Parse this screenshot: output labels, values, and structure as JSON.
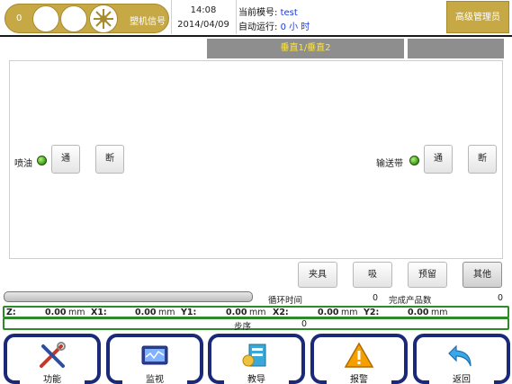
{
  "header": {
    "signal_count": "0",
    "signal_label": "塑机信号",
    "time": "14:08",
    "date": "2014/04/09",
    "mold_label": "当前模号:",
    "mold_value": "test",
    "auto_label": "自动运行:",
    "auto_value": "0 小 时",
    "admin_label": "高级管理员"
  },
  "tabs": {
    "active_label": "垂直1/垂直2",
    "second_label": ""
  },
  "controls": {
    "spray_label": "喷油",
    "spray_on": "通",
    "spray_off": "断",
    "conveyor_label": "输送带",
    "conveyor_on": "通",
    "conveyor_off": "断"
  },
  "actions": {
    "clamp": "夹具",
    "suction": "吸",
    "reserve": "预留",
    "other": "其他"
  },
  "status": {
    "cycle_time_label": "循环时间",
    "cycle_time_value": "0",
    "finished_label": "完成产品数",
    "finished_value": "0",
    "progress": 0
  },
  "coords": [
    {
      "label": "Z:",
      "value": "0.00",
      "unit": "mm"
    },
    {
      "label": "X1:",
      "value": "0.00",
      "unit": "mm"
    },
    {
      "label": "Y1:",
      "value": "0.00",
      "unit": "mm"
    },
    {
      "label": "X2:",
      "value": "0.00",
      "unit": "mm"
    },
    {
      "label": "Y2:",
      "value": "0.00",
      "unit": "mm"
    }
  ],
  "step": {
    "label": "步序",
    "value": "0"
  },
  "nav": [
    {
      "label": "功能",
      "icon": "tools-icon"
    },
    {
      "label": "监视",
      "icon": "monitor-icon"
    },
    {
      "label": "教导",
      "icon": "teach-icon"
    },
    {
      "label": "报警",
      "icon": "warning-icon"
    },
    {
      "label": "返回",
      "icon": "return-arrow-icon"
    }
  ],
  "colors": {
    "gold": "#c6a845",
    "nav_blue": "#1a2a78",
    "status_green": "#2e8a28",
    "value_blue": "#1a3bd8",
    "tab_text": "#ffe53b"
  }
}
